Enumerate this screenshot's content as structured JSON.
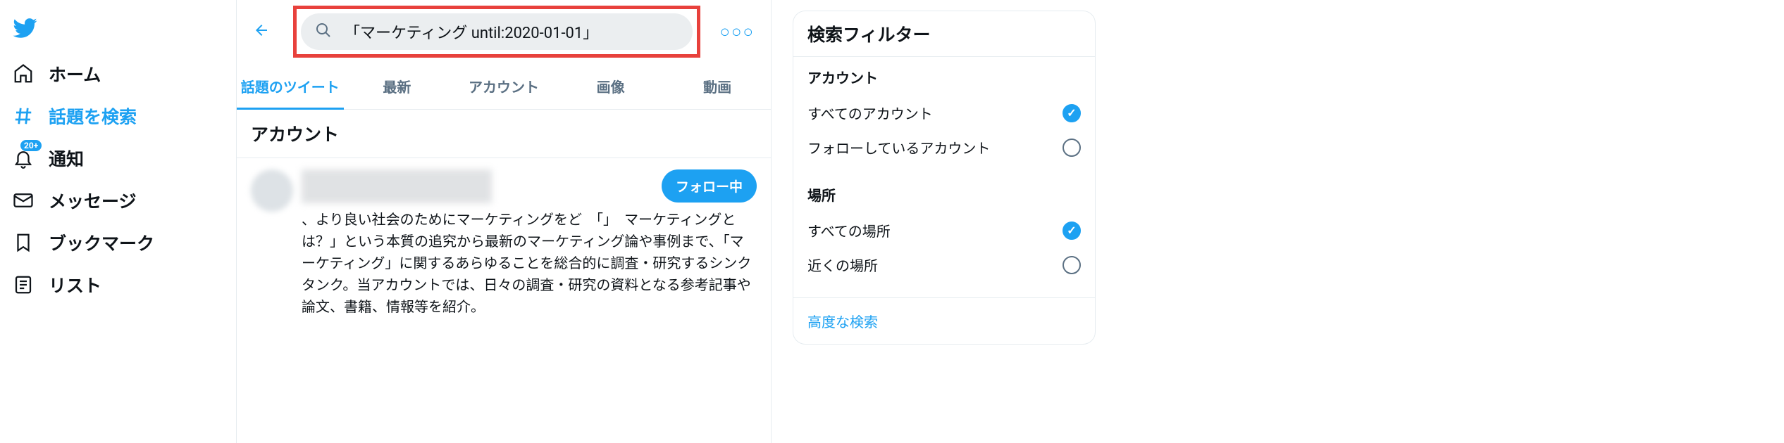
{
  "sidebar": {
    "items": [
      {
        "label": "ホーム"
      },
      {
        "label": "話題を検索"
      },
      {
        "label": "通知",
        "badge": "20+"
      },
      {
        "label": "メッセージ"
      },
      {
        "label": "ブックマーク"
      },
      {
        "label": "リスト"
      }
    ]
  },
  "search": {
    "query": "「マーケティング until:2020-01-01」"
  },
  "tabs": [
    {
      "label": "話題のツイート"
    },
    {
      "label": "最新"
    },
    {
      "label": "アカウント"
    },
    {
      "label": "画像"
    },
    {
      "label": "動画"
    }
  ],
  "section_header": "アカウント",
  "account": {
    "follow_button": "フォロー中",
    "description": "、より良い社会のためにマーケティングをど　「」　マーケティングとは？」という本質の追究から最新のマーケティング論や事例まで、「マーケティング」に関するあらゆることを総合的に調査・研究するシンクタンク。当アカウントでは、日々の調査・研究の資料となる参考記事や論文、書籍、情報等を紹介。"
  },
  "filters": {
    "title": "検索フィルター",
    "account_section": {
      "label": "アカウント",
      "options": [
        {
          "label": "すべてのアカウント",
          "selected": true
        },
        {
          "label": "フォローしているアカウント",
          "selected": false
        }
      ]
    },
    "location_section": {
      "label": "場所",
      "options": [
        {
          "label": "すべての場所",
          "selected": true
        },
        {
          "label": "近くの場所",
          "selected": false
        }
      ]
    },
    "advanced": "高度な検索"
  }
}
